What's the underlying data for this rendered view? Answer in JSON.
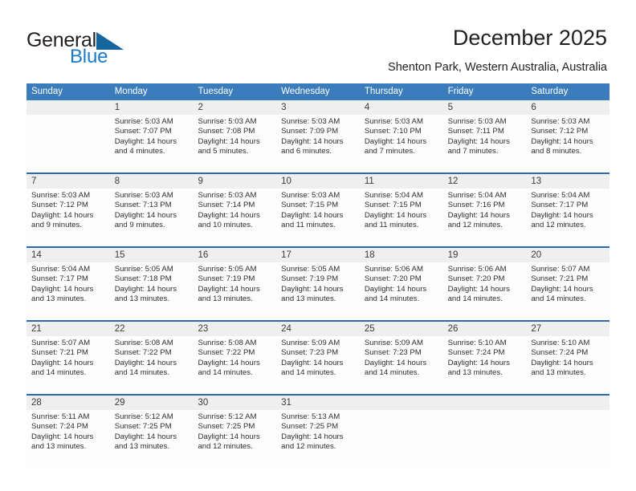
{
  "brand": {
    "name_part1": "General",
    "name_part2": "Blue",
    "accent_color": "#1b7ac9",
    "triangle_color": "#15659e"
  },
  "header": {
    "title": "December 2025",
    "subtitle": "Shenton Park, Western Australia, Australia"
  },
  "calendar": {
    "header_bg": "#3b7cbd",
    "row_divider_color": "#2a6aad",
    "daynum_bg": "#efefef",
    "weekdays": [
      "Sunday",
      "Monday",
      "Tuesday",
      "Wednesday",
      "Thursday",
      "Friday",
      "Saturday"
    ],
    "weeks": [
      {
        "days": [
          {
            "num": "",
            "sunrise": "",
            "sunset": "",
            "daylight": ""
          },
          {
            "num": "1",
            "sunrise": "Sunrise: 5:03 AM",
            "sunset": "Sunset: 7:07 PM",
            "daylight": "Daylight: 14 hours and 4 minutes."
          },
          {
            "num": "2",
            "sunrise": "Sunrise: 5:03 AM",
            "sunset": "Sunset: 7:08 PM",
            "daylight": "Daylight: 14 hours and 5 minutes."
          },
          {
            "num": "3",
            "sunrise": "Sunrise: 5:03 AM",
            "sunset": "Sunset: 7:09 PM",
            "daylight": "Daylight: 14 hours and 6 minutes."
          },
          {
            "num": "4",
            "sunrise": "Sunrise: 5:03 AM",
            "sunset": "Sunset: 7:10 PM",
            "daylight": "Daylight: 14 hours and 7 minutes."
          },
          {
            "num": "5",
            "sunrise": "Sunrise: 5:03 AM",
            "sunset": "Sunset: 7:11 PM",
            "daylight": "Daylight: 14 hours and 7 minutes."
          },
          {
            "num": "6",
            "sunrise": "Sunrise: 5:03 AM",
            "sunset": "Sunset: 7:12 PM",
            "daylight": "Daylight: 14 hours and 8 minutes."
          }
        ]
      },
      {
        "days": [
          {
            "num": "7",
            "sunrise": "Sunrise: 5:03 AM",
            "sunset": "Sunset: 7:12 PM",
            "daylight": "Daylight: 14 hours and 9 minutes."
          },
          {
            "num": "8",
            "sunrise": "Sunrise: 5:03 AM",
            "sunset": "Sunset: 7:13 PM",
            "daylight": "Daylight: 14 hours and 9 minutes."
          },
          {
            "num": "9",
            "sunrise": "Sunrise: 5:03 AM",
            "sunset": "Sunset: 7:14 PM",
            "daylight": "Daylight: 14 hours and 10 minutes."
          },
          {
            "num": "10",
            "sunrise": "Sunrise: 5:03 AM",
            "sunset": "Sunset: 7:15 PM",
            "daylight": "Daylight: 14 hours and 11 minutes."
          },
          {
            "num": "11",
            "sunrise": "Sunrise: 5:04 AM",
            "sunset": "Sunset: 7:15 PM",
            "daylight": "Daylight: 14 hours and 11 minutes."
          },
          {
            "num": "12",
            "sunrise": "Sunrise: 5:04 AM",
            "sunset": "Sunset: 7:16 PM",
            "daylight": "Daylight: 14 hours and 12 minutes."
          },
          {
            "num": "13",
            "sunrise": "Sunrise: 5:04 AM",
            "sunset": "Sunset: 7:17 PM",
            "daylight": "Daylight: 14 hours and 12 minutes."
          }
        ]
      },
      {
        "days": [
          {
            "num": "14",
            "sunrise": "Sunrise: 5:04 AM",
            "sunset": "Sunset: 7:17 PM",
            "daylight": "Daylight: 14 hours and 13 minutes."
          },
          {
            "num": "15",
            "sunrise": "Sunrise: 5:05 AM",
            "sunset": "Sunset: 7:18 PM",
            "daylight": "Daylight: 14 hours and 13 minutes."
          },
          {
            "num": "16",
            "sunrise": "Sunrise: 5:05 AM",
            "sunset": "Sunset: 7:19 PM",
            "daylight": "Daylight: 14 hours and 13 minutes."
          },
          {
            "num": "17",
            "sunrise": "Sunrise: 5:05 AM",
            "sunset": "Sunset: 7:19 PM",
            "daylight": "Daylight: 14 hours and 13 minutes."
          },
          {
            "num": "18",
            "sunrise": "Sunrise: 5:06 AM",
            "sunset": "Sunset: 7:20 PM",
            "daylight": "Daylight: 14 hours and 14 minutes."
          },
          {
            "num": "19",
            "sunrise": "Sunrise: 5:06 AM",
            "sunset": "Sunset: 7:20 PM",
            "daylight": "Daylight: 14 hours and 14 minutes."
          },
          {
            "num": "20",
            "sunrise": "Sunrise: 5:07 AM",
            "sunset": "Sunset: 7:21 PM",
            "daylight": "Daylight: 14 hours and 14 minutes."
          }
        ]
      },
      {
        "days": [
          {
            "num": "21",
            "sunrise": "Sunrise: 5:07 AM",
            "sunset": "Sunset: 7:21 PM",
            "daylight": "Daylight: 14 hours and 14 minutes."
          },
          {
            "num": "22",
            "sunrise": "Sunrise: 5:08 AM",
            "sunset": "Sunset: 7:22 PM",
            "daylight": "Daylight: 14 hours and 14 minutes."
          },
          {
            "num": "23",
            "sunrise": "Sunrise: 5:08 AM",
            "sunset": "Sunset: 7:22 PM",
            "daylight": "Daylight: 14 hours and 14 minutes."
          },
          {
            "num": "24",
            "sunrise": "Sunrise: 5:09 AM",
            "sunset": "Sunset: 7:23 PM",
            "daylight": "Daylight: 14 hours and 14 minutes."
          },
          {
            "num": "25",
            "sunrise": "Sunrise: 5:09 AM",
            "sunset": "Sunset: 7:23 PM",
            "daylight": "Daylight: 14 hours and 14 minutes."
          },
          {
            "num": "26",
            "sunrise": "Sunrise: 5:10 AM",
            "sunset": "Sunset: 7:24 PM",
            "daylight": "Daylight: 14 hours and 13 minutes."
          },
          {
            "num": "27",
            "sunrise": "Sunrise: 5:10 AM",
            "sunset": "Sunset: 7:24 PM",
            "daylight": "Daylight: 14 hours and 13 minutes."
          }
        ]
      },
      {
        "days": [
          {
            "num": "28",
            "sunrise": "Sunrise: 5:11 AM",
            "sunset": "Sunset: 7:24 PM",
            "daylight": "Daylight: 14 hours and 13 minutes."
          },
          {
            "num": "29",
            "sunrise": "Sunrise: 5:12 AM",
            "sunset": "Sunset: 7:25 PM",
            "daylight": "Daylight: 14 hours and 13 minutes."
          },
          {
            "num": "30",
            "sunrise": "Sunrise: 5:12 AM",
            "sunset": "Sunset: 7:25 PM",
            "daylight": "Daylight: 14 hours and 12 minutes."
          },
          {
            "num": "31",
            "sunrise": "Sunrise: 5:13 AM",
            "sunset": "Sunset: 7:25 PM",
            "daylight": "Daylight: 14 hours and 12 minutes."
          },
          {
            "num": "",
            "sunrise": "",
            "sunset": "",
            "daylight": ""
          },
          {
            "num": "",
            "sunrise": "",
            "sunset": "",
            "daylight": ""
          },
          {
            "num": "",
            "sunrise": "",
            "sunset": "",
            "daylight": ""
          }
        ]
      }
    ]
  }
}
